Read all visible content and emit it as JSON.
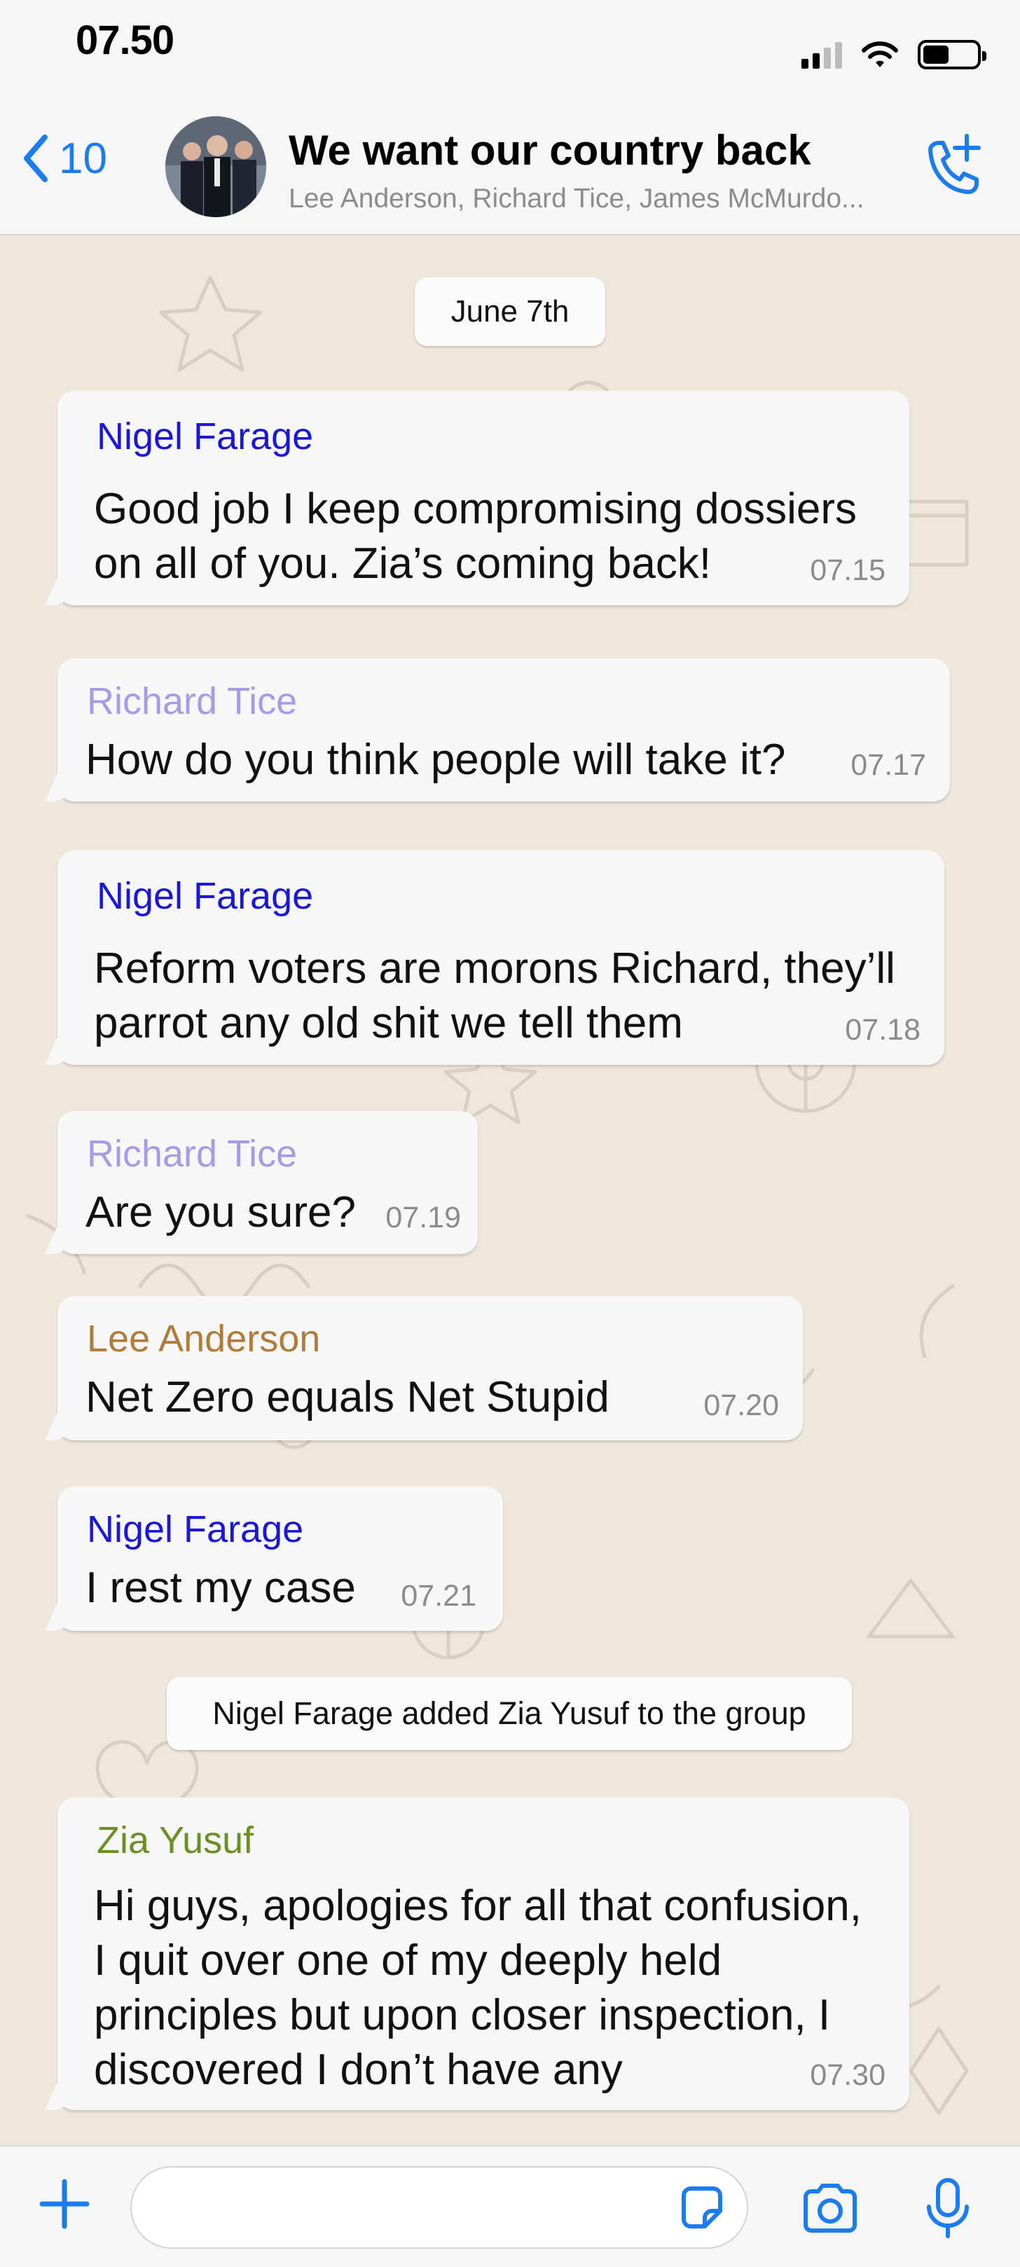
{
  "status_bar": {
    "time": "07.50"
  },
  "header": {
    "back_count": "10",
    "group_name": "We want our country back",
    "members": "Lee Anderson, Richard Tice, James McMurdo..."
  },
  "chat": {
    "date_label": "June 7th",
    "system_message": "Nigel Farage added Zia Yusuf to the group",
    "messages": [
      {
        "sender": "Nigel Farage",
        "sender_color": "#1a17d8",
        "lines": [
          "Good job I keep compromising dossiers",
          "on all of you. Zia’s coming back!"
        ],
        "time": "07.15"
      },
      {
        "sender": "Richard Tice",
        "sender_color": "#a89be6",
        "lines": [
          "How do you think people will take it?"
        ],
        "time": "07.17"
      },
      {
        "sender": "Nigel Farage",
        "sender_color": "#1a17d8",
        "lines": [
          "Reform voters are morons Richard, they’ll",
          "parrot any old shit we tell them"
        ],
        "time": "07.18"
      },
      {
        "sender": "Richard Tice",
        "sender_color": "#a89be6",
        "lines": [
          "Are you sure?"
        ],
        "time": "07.19"
      },
      {
        "sender": "Lee Anderson",
        "sender_color": "#b07c3a",
        "lines": [
          "Net Zero equals Net Stupid"
        ],
        "time": "07.20"
      },
      {
        "sender": "Nigel Farage",
        "sender_color": "#1a17d8",
        "lines": [
          "I rest my case"
        ],
        "time": "07.21"
      },
      {
        "sender": "Zia Yusuf",
        "sender_color": "#6a8f23",
        "lines": [
          "Hi guys, apologies for all that confusion,",
          "I quit over one of my deeply held",
          "principles but upon closer inspection, I",
          "discovered I don’t have any"
        ],
        "time": "07.30"
      }
    ]
  },
  "input_bar": {
    "placeholder": ""
  },
  "icons": {
    "back": "chevron-left-icon",
    "call": "add-call-icon",
    "plus": "plus-icon",
    "sticker": "sticker-icon",
    "camera": "camera-icon",
    "mic": "microphone-icon"
  },
  "colors": {
    "accent": "#1b7cf0",
    "chat_background": "#efe7dc",
    "bubble": "#f7f7f7"
  }
}
